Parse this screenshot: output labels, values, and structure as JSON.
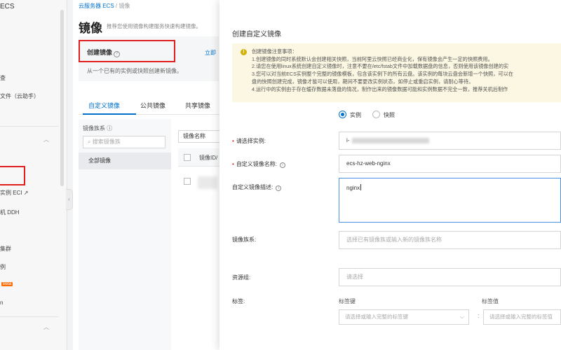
{
  "leftnav": {
    "brand": "ECS",
    "items": [
      {
        "label": "查"
      },
      {
        "label": "文件（云助手）"
      },
      {
        "label": "实例 ECI"
      },
      {
        "label": "机 DDH"
      },
      {
        "label": "集群"
      },
      {
        "label": "例"
      },
      {
        "label": "Beta"
      },
      {
        "label": "n"
      }
    ],
    "hot_badge": "Beta"
  },
  "main": {
    "breadcrumb": {
      "root": "云服务器 ECS",
      "sep": "/",
      "current": "镜像"
    },
    "page_title": "镜像",
    "page_subtitle": "推荐您使用镜像构建服务快速构建镜像。",
    "card": {
      "title": "创建镜像",
      "desc": "从一个已有的实例或快照创建新镜像。"
    },
    "side_link": "立即",
    "tabs": [
      {
        "label": "自定义镜像"
      },
      {
        "label": "公共镜像"
      },
      {
        "label": "共享镜像"
      }
    ],
    "facet": {
      "title": "镜像族系",
      "search_placeholder": "搜索镜像族",
      "all": "全部镜像"
    },
    "table": {
      "filter": "镜像名称",
      "header": "镜像ID/"
    }
  },
  "drawer": {
    "title": "创建自定义镜像",
    "notice": {
      "title": "创建镜像注意事项：",
      "lines": [
        "1.创建镜像的同时系统默认会创建相关快照，当前阿里云快照已经商业化，保有镜像会产生一定的快照费用。",
        "2.请您在使用linux系统创建自定义镜像时，注意不要在/etc/fstab文件中加载数据盘的信息，否则使用该镜像创建的实",
        "3.您可以对当前ECS实例整个完整的镜像模板，包含该实例下的所有云盘。该实例的每块云盘会新增一个快照，可以在",
        "盘的快照创建完成，镜像才能可以使用，期间不要更改实例状态，如停止或重启实例，请耐心等待。",
        "4.运行中的实例由于存在缓存数据未落盘的情况，制作出来的镜像数据可能和实例数据不完全一致，推荐关机后制作"
      ]
    },
    "source": {
      "options": [
        "实例",
        "快照"
      ],
      "selected": "实例"
    },
    "form": {
      "instance_label": "请选择实例:",
      "instance_value": "i-",
      "name_label": "自定义镜像名称:",
      "name_value": "ecs-hz-web-nginx",
      "desc_label": "自定义镜像描述:",
      "desc_value": "nginx",
      "family_label": "镜像族系:",
      "family_placeholder": "选择已有镜像族或输入新的镜像族名称",
      "rg_label": "资源组:",
      "rg_placeholder": "请选择",
      "tag_label": "标签:",
      "tag_key_label": "标签键",
      "tag_value_label": "标签值",
      "tag_key_placeholder": "请选择或输入完整的标签键",
      "tag_value_placeholder": "请选择或输入完整的标签值",
      "colon": ":"
    },
    "colors": {
      "accent": "#0070cc",
      "notice_bg": "#fbf7e2",
      "highlight": "#e02020",
      "required": "#e02020"
    }
  }
}
